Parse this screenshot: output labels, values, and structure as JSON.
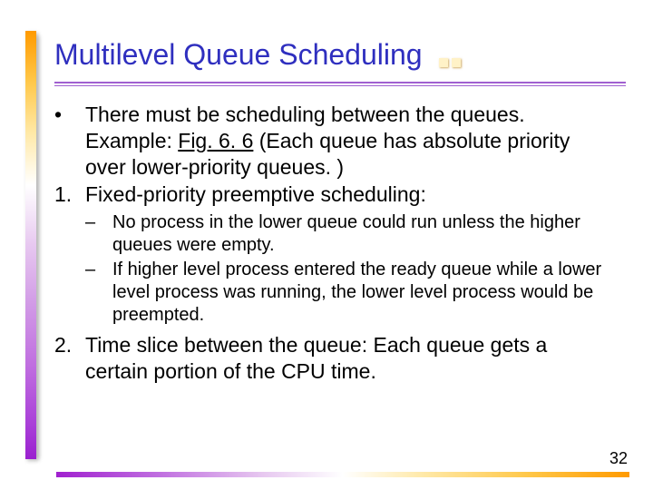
{
  "title": "Multilevel Queue Scheduling",
  "bullets": [
    {
      "marker": "•",
      "text_before": "There must be scheduling between the queues. Example: ",
      "link_text": "Fig. 6. 6",
      "text_after": " (Each queue has absolute priority over lower-priority queues. )"
    },
    {
      "marker": "1.",
      "text": "Fixed-priority preemptive scheduling:",
      "sub": [
        {
          "marker": "–",
          "text": "No process in the lower queue could run unless the higher queues were empty."
        },
        {
          "marker": "–",
          "text": "If higher level process entered the ready queue while a lower level process was running, the lower level process would be preempted."
        }
      ]
    },
    {
      "marker": "2.",
      "text": "Time slice between the queue: Each queue gets a certain portion of the CPU time."
    }
  ],
  "page_number": "32"
}
